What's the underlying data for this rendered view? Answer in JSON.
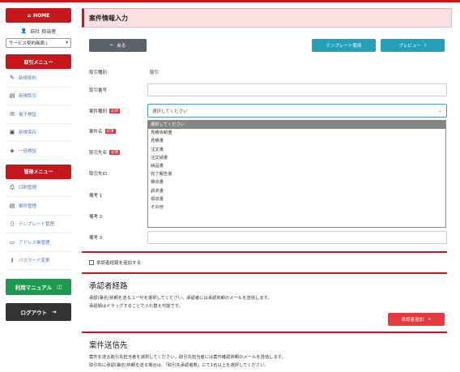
{
  "sidebar": {
    "home": "HOME",
    "user": "自社 担当者",
    "service_select": "サービス契約画面 (",
    "torihiki_menu_title": "取引メニュー",
    "torihiki_items": [
      "新規契約",
      "新規取引",
      "電子検証",
      "新規保存",
      "一括検証"
    ],
    "kanri_menu_title": "管理メニュー",
    "kanri_items": [
      "印刷管理",
      "案件管理",
      "テンプレート管理",
      "アドレス帳管理",
      "パスワード変更"
    ],
    "manual": "利用マニュアル",
    "logout": "ログアウト"
  },
  "page_title": "案件情報入力",
  "buttons": {
    "back": "戻る",
    "template": "テンプレート使用",
    "preview": "プレビュー"
  },
  "form": {
    "torihiki_shubetsu_label": "取引種別",
    "torihiki_shubetsu_value": "取引",
    "torihiki_bango_label": "取引番号",
    "anken_shubetsu_label": "案件種別",
    "anken_mei_label": "案件名",
    "torihikisaki_mei_label": "取引先名",
    "torihikisaki_id_label": "取引先ID",
    "biko1_label": "備考 1",
    "biko2_label": "備考 2",
    "biko3_label": "備考 3",
    "required_badge": "必須",
    "select_placeholder": "選択してください",
    "options": [
      "選択してください",
      "見積依頼書",
      "見積書",
      "注文書",
      "注文請書",
      "納品書",
      "完了報告書",
      "検収書",
      "請求書",
      "領収書",
      "その他"
    ]
  },
  "approval_checkbox_label": "承認者経路を追加する",
  "approval": {
    "title": "承認者経路",
    "desc1": "承認(署名)依頼を送るユーザを選択してください。承認者には承認依頼のメールを送信します。",
    "desc2": "承認順はドラッグすることで入れ替え可能です。",
    "add_button": "承認者追加"
  },
  "send": {
    "title": "案件送信先",
    "desc1": "案件を送る取引先担当者を選択してください。取引先担当者には案件確認依頼のメールを送信します。",
    "desc2": "取引先に承認(署名)依頼を送る場合は、「取引先承認者数」にて1名以上を選択してください。"
  }
}
